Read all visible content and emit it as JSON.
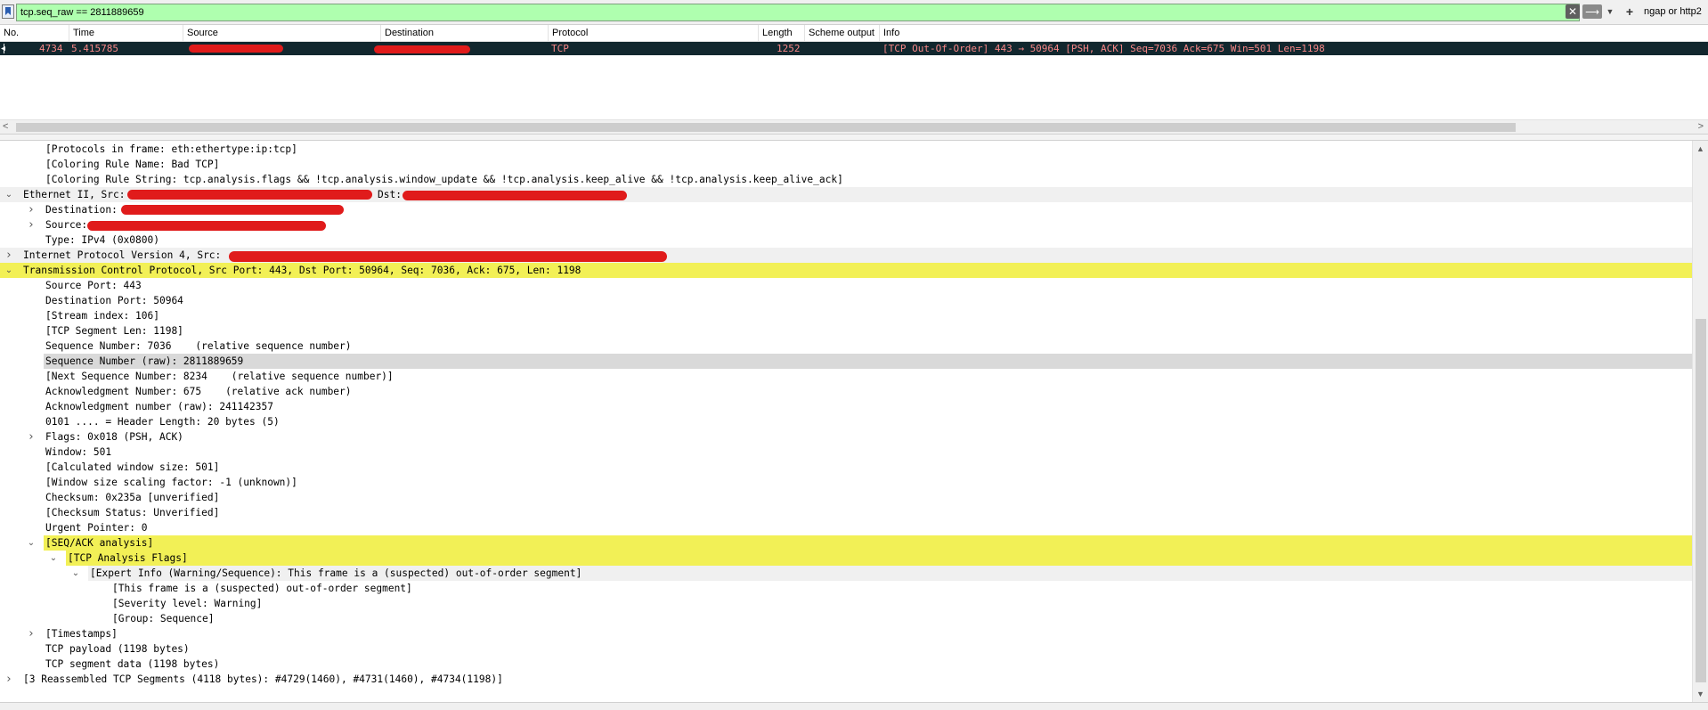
{
  "filter": {
    "value": "tcp.seq_raw == 2811889659",
    "clear_icon": "close-icon",
    "apply_icon": "arrow-right-icon",
    "dropdown_icon": "chevron-down-icon",
    "add_icon": "plus-icon",
    "filter_button_label": "ngap or http2"
  },
  "packet_list": {
    "columns": [
      "No.",
      "Time",
      "Source",
      "Destination",
      "Protocol",
      "Length",
      "Scheme output",
      "Info"
    ],
    "row": {
      "no": "4734",
      "time": "5.415785",
      "source": "",
      "destination": "",
      "protocol": "TCP",
      "length": "1252",
      "scheme_output": "",
      "info": "[TCP Out-Of-Order] 443 → 50964 [PSH, ACK] Seq=7036 Ack=675 Win=501 Len=1198"
    }
  },
  "tree": [
    {
      "text": "[Protocols in frame: eth:ethertype:ip:tcp]",
      "indent": 2,
      "arrow": "none",
      "hl": ""
    },
    {
      "text": "[Coloring Rule Name: Bad TCP]",
      "indent": 2,
      "arrow": "none",
      "hl": ""
    },
    {
      "text": "[Coloring Rule String: tcp.analysis.flags && !tcp.analysis.window_update && !tcp.analysis.keep_alive && !tcp.analysis.keep_alive_ack]",
      "indent": 2,
      "arrow": "none",
      "hl": ""
    },
    {
      "text": "Ethernet II, Src:",
      "suffix": "Dst:",
      "indent": 1,
      "arrow": "open",
      "hl": "gray"
    },
    {
      "text": "Destination:",
      "indent": 2,
      "arrow": "closed",
      "hl": ""
    },
    {
      "text": "Source:",
      "indent": 2,
      "arrow": "closed",
      "hl": ""
    },
    {
      "text": "Type: IPv4 (0x0800)",
      "indent": 2,
      "arrow": "none",
      "hl": ""
    },
    {
      "text": "Internet Protocol Version 4, Src:",
      "indent": 1,
      "arrow": "closed",
      "hl": "gray"
    },
    {
      "text": "Transmission Control Protocol, Src Port: 443, Dst Port: 50964, Seq: 7036, Ack: 675, Len: 1198",
      "indent": 1,
      "arrow": "open",
      "hl": "yellow"
    },
    {
      "text": "Source Port: 443",
      "indent": 2,
      "arrow": "none",
      "hl": ""
    },
    {
      "text": "Destination Port: 50964",
      "indent": 2,
      "arrow": "none",
      "hl": ""
    },
    {
      "text": "[Stream index: 106]",
      "indent": 2,
      "arrow": "none",
      "hl": ""
    },
    {
      "text": "[TCP Segment Len: 1198]",
      "indent": 2,
      "arrow": "none",
      "hl": ""
    },
    {
      "text": "Sequence Number: 7036    (relative sequence number)",
      "indent": 2,
      "arrow": "none",
      "hl": ""
    },
    {
      "text": "Sequence Number (raw): 2811889659",
      "indent": 2,
      "arrow": "none",
      "hl": "sel"
    },
    {
      "text": "[Next Sequence Number: 8234    (relative sequence number)]",
      "indent": 2,
      "arrow": "none",
      "hl": ""
    },
    {
      "text": "Acknowledgment Number: 675    (relative ack number)",
      "indent": 2,
      "arrow": "none",
      "hl": ""
    },
    {
      "text": "Acknowledgment number (raw): 241142357",
      "indent": 2,
      "arrow": "none",
      "hl": ""
    },
    {
      "text": "0101 .... = Header Length: 20 bytes (5)",
      "indent": 2,
      "arrow": "none",
      "hl": ""
    },
    {
      "text": "Flags: 0x018 (PSH, ACK)",
      "indent": 2,
      "arrow": "closed",
      "hl": ""
    },
    {
      "text": "Window: 501",
      "indent": 2,
      "arrow": "none",
      "hl": ""
    },
    {
      "text": "[Calculated window size: 501]",
      "indent": 2,
      "arrow": "none",
      "hl": ""
    },
    {
      "text": "[Window size scaling factor: -1 (unknown)]",
      "indent": 2,
      "arrow": "none",
      "hl": ""
    },
    {
      "text": "Checksum: 0x235a [unverified]",
      "indent": 2,
      "arrow": "none",
      "hl": ""
    },
    {
      "text": "[Checksum Status: Unverified]",
      "indent": 2,
      "arrow": "none",
      "hl": ""
    },
    {
      "text": "Urgent Pointer: 0",
      "indent": 2,
      "arrow": "none",
      "hl": ""
    },
    {
      "text": "[SEQ/ACK analysis]",
      "indent": 2,
      "arrow": "open",
      "hl": "yellow"
    },
    {
      "text": "[TCP Analysis Flags]",
      "indent": 3,
      "arrow": "open",
      "hl": "yellow"
    },
    {
      "text": "[Expert Info (Warning/Sequence): This frame is a (suspected) out-of-order segment]",
      "indent": 4,
      "arrow": "open",
      "hl": "gray"
    },
    {
      "text": "[This frame is a (suspected) out-of-order segment]",
      "indent": 5,
      "arrow": "none",
      "hl": ""
    },
    {
      "text": "[Severity level: Warning]",
      "indent": 5,
      "arrow": "none",
      "hl": ""
    },
    {
      "text": "[Group: Sequence]",
      "indent": 5,
      "arrow": "none",
      "hl": ""
    },
    {
      "text": "[Timestamps]",
      "indent": 2,
      "arrow": "closed",
      "hl": ""
    },
    {
      "text": "TCP payload (1198 bytes)",
      "indent": 2,
      "arrow": "none",
      "hl": ""
    },
    {
      "text": "TCP segment data (1198 bytes)",
      "indent": 2,
      "arrow": "none",
      "hl": ""
    },
    {
      "text": "[3 Reassembled TCP Segments (4118 bytes): #4729(1460), #4731(1460), #4734(1198)]",
      "indent": 1,
      "arrow": "closed",
      "hl": ""
    }
  ],
  "colors": {
    "filter_valid_bg": "#afffaf",
    "bad_tcp_row_bg": "#12272e",
    "bad_tcp_row_fg": "#f78787",
    "highlight_yellow": "#f2f056",
    "redaction_red": "#e01b1b"
  }
}
